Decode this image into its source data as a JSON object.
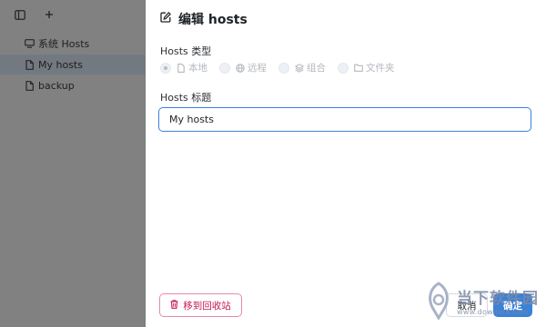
{
  "sidebar": {
    "toolbar": {
      "toggle_icon": "sidebar-toggle-icon",
      "add_icon": "plus-icon"
    },
    "items": [
      {
        "label": "系统 Hosts",
        "icon": "monitor-icon",
        "active": false
      },
      {
        "label": "My hosts",
        "icon": "file-icon",
        "active": true
      },
      {
        "label": "backup",
        "icon": "file-icon",
        "active": false
      }
    ]
  },
  "dialog": {
    "title": "编辑 hosts",
    "title_icon": "edit-icon",
    "type_label": "Hosts 类型",
    "type_options": [
      {
        "label": "本地",
        "icon": "file-icon",
        "selected": true
      },
      {
        "label": "远程",
        "icon": "globe-icon",
        "selected": false
      },
      {
        "label": "组合",
        "icon": "layers-icon",
        "selected": false
      },
      {
        "label": "文件夹",
        "icon": "folder-icon",
        "selected": false
      }
    ],
    "hosts_title_label": "Hosts 标题",
    "hosts_title_value": "My hosts",
    "trash_button": "移到回收站",
    "cancel_button": "取消",
    "ok_button": "确定"
  },
  "watermark": {
    "name": "当下软件园",
    "url": "www.downxia.com"
  },
  "colors": {
    "accent": "#3b82d6",
    "danger": "#c8194e",
    "active_item": "#dbe8fb"
  }
}
